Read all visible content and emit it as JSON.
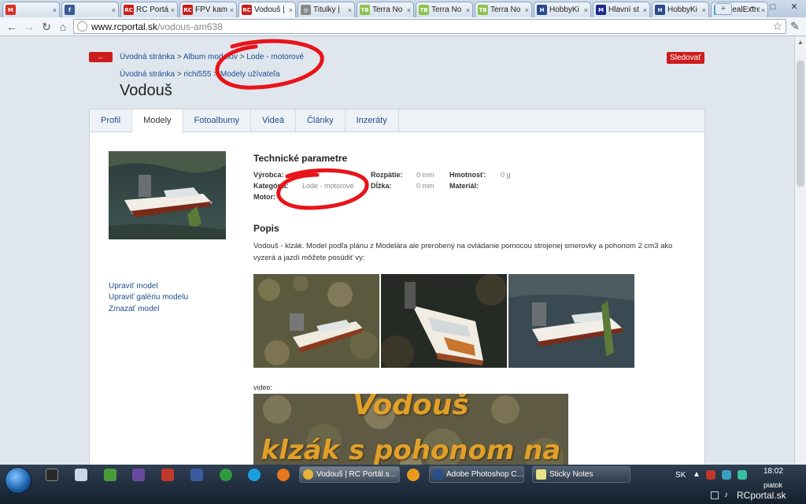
{
  "browser": {
    "tabs": [
      {
        "favicon": "gmail-icon",
        "color": "#d93025",
        "glyph": "M",
        "title": ""
      },
      {
        "favicon": "facebook-icon",
        "color": "#3b5998",
        "glyph": "f",
        "title": ""
      },
      {
        "favicon": "rcportal-icon",
        "color": "#cc1b1b",
        "glyph": "RC",
        "title": "RC Portá"
      },
      {
        "favicon": "rcportal-icon",
        "color": "#cc1b1b",
        "glyph": "RC",
        "title": "FPV kam"
      },
      {
        "favicon": "rcportal-icon",
        "color": "#cc1b1b",
        "glyph": "RC",
        "title": "Vodouš |"
      },
      {
        "favicon": "subtitles-icon",
        "color": "#888888",
        "glyph": "◎",
        "title": "Titulky |"
      },
      {
        "favicon": "terranova-icon",
        "color": "#8bc34a",
        "glyph": "TB",
        "title": "Terra No"
      },
      {
        "favicon": "terranova-icon",
        "color": "#8bc34a",
        "glyph": "TB",
        "title": "Terra No"
      },
      {
        "favicon": "terranova-icon",
        "color": "#8bc34a",
        "glyph": "TB",
        "title": "Terra No"
      },
      {
        "favicon": "hobbyking-icon",
        "color": "#2a4a8a",
        "glyph": "H",
        "title": "HobbyKi"
      },
      {
        "favicon": "metro-icon",
        "color": "#1a2a8a",
        "glyph": "M",
        "title": "Hlavní st"
      },
      {
        "favicon": "hobbyking-icon",
        "color": "#2a4a8a",
        "glyph": "H",
        "title": "HobbyKi"
      },
      {
        "favicon": "dealextreme-icon",
        "color": "#1ea0c8",
        "glyph": "DX",
        "title": "DealExtre"
      }
    ],
    "address": {
      "host": "www.rcportal.sk",
      "path": "/vodous-am638"
    }
  },
  "page": {
    "breadcrumb1": {
      "home": "Úvodná stránka",
      "album": "Album modelov",
      "category": "Lode - motorové",
      "sep": ">"
    },
    "breadcrumb2": {
      "home": "Úvodná stránka",
      "user": "richi555",
      "models": "Modely užívateľa",
      "sep": ">"
    },
    "back_label": "←",
    "follow_label": "Sledovať",
    "title": "Vodouš",
    "tabs": [
      "Profil",
      "Modely",
      "Fotoalbumy",
      "Videá",
      "Články",
      "Inzeráty"
    ],
    "active_tab": 1,
    "side_links": [
      "Upraviť model",
      "Upraviť galériu modelu",
      "Zmazať model"
    ],
    "params_heading": "Technické parametre",
    "params": {
      "vyrobca_label": "Výrobca:",
      "kategoria_label": "Kategória:",
      "kategoria_value": "Lode - motorové",
      "motor_label": "Motor:",
      "rozpatie_label": "Rozpätie:",
      "rozpatie_value": "0 mm",
      "dlzka_label": "Dĺžka:",
      "dlzka_value": "0 mm",
      "hmotnost_label": "Hmotnosť:",
      "hmotnost_value": "0 g",
      "material_label": "Materiál:"
    },
    "popis_heading": "Popis",
    "description": "Vodouš - klzák. Model podľa plánu z Modelára ale prerobený na ovládanie pomocou strojenej smerovky a pohonom 2 cm3 ako vyzerá a jazdí môžete posúdiť vy:",
    "video_label": "video:",
    "video_text_line1": "Vodouš",
    "video_text_line2": "klzák s pohonom na"
  },
  "taskbar": {
    "tasks": [
      {
        "label": "Vodouš | RC Portál.s...",
        "icon": "chrome-icon",
        "color": "#e8b33a"
      },
      {
        "label": "Adobe Photoshop C...",
        "icon": "photoshop-icon",
        "color": "#2b4e8c"
      },
      {
        "label": "Sticky Notes",
        "icon": "sticky-notes-icon",
        "color": "#e6e28a"
      }
    ],
    "language": "SK",
    "time": "18:02",
    "day": "piatok",
    "watermark": "RCportal.sk"
  }
}
